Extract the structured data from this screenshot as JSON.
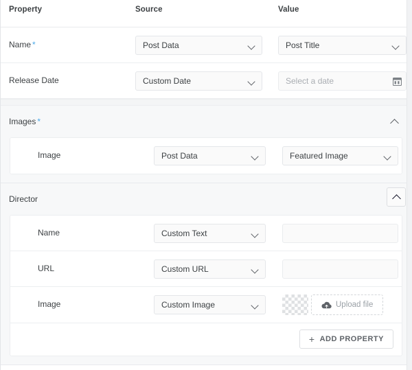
{
  "columns": {
    "property": "Property",
    "source": "Source",
    "value": "Value"
  },
  "required_marker": "*",
  "rows": [
    {
      "label": "Name",
      "required": true,
      "source": "Post Data",
      "value": "Post Title",
      "value_type": "select"
    },
    {
      "label": "Release Date",
      "required": false,
      "source": "Custom Date",
      "value": "",
      "value_placeholder": "Select a date",
      "value_type": "date",
      "value_icon": "calendar-icon"
    }
  ],
  "groups": [
    {
      "title": "Images",
      "required": true,
      "collapsed": false,
      "collapse_icon": "chevron-up-icon",
      "collapse_style": "plain",
      "has_add_property": false,
      "rows": [
        {
          "label": "Image",
          "source": "Post Data",
          "value": "Featured Image",
          "value_type": "select"
        }
      ]
    },
    {
      "title": "Director",
      "required": false,
      "collapsed": false,
      "collapse_icon": "chevron-up-icon",
      "collapse_style": "button",
      "has_add_property": true,
      "add_property_label": "ADD PROPERTY",
      "add_property_icon": "plus-icon",
      "rows": [
        {
          "label": "Name",
          "source": "Custom Text",
          "value": "",
          "value_type": "text"
        },
        {
          "label": "URL",
          "source": "Custom URL",
          "value": "",
          "value_type": "text"
        },
        {
          "label": "Image",
          "source": "Custom Image",
          "value_type": "upload",
          "upload_label": "Upload file",
          "upload_icon": "cloud-upload-icon",
          "thumbnail": "transparent-checkerboard"
        }
      ]
    }
  ],
  "colors": {
    "accent_required": "#4aa8e8",
    "text": "#3c4043",
    "muted": "#9aa0a6",
    "border": "#e4e6e9",
    "group_bg": "#f7f8f9",
    "control_bg": "#fafafa"
  }
}
